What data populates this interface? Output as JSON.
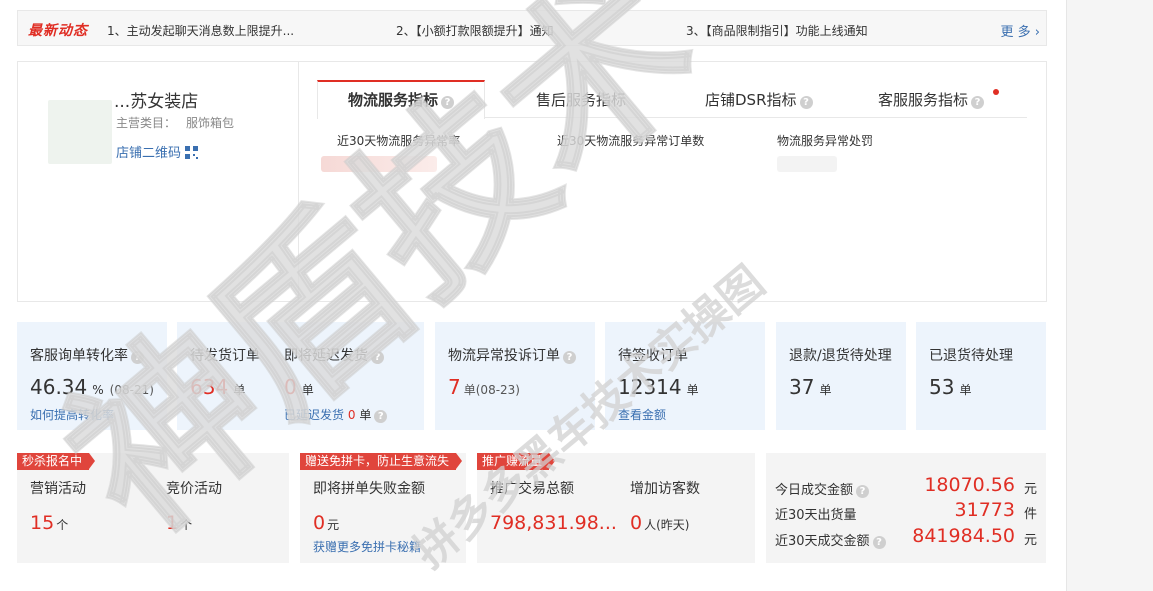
{
  "news": {
    "badge": "最新动态",
    "items": [
      "1、主动发起聊天消息数上限提升...",
      "2、【小额打款限额提升】通知",
      "3、【商品限制指引】功能上线通知"
    ],
    "more": "更 多 ›"
  },
  "shop": {
    "name": "...苏女装店",
    "category_label": "主营类目：",
    "category_value": "服饰箱包",
    "qr_link": "店铺二维码"
  },
  "tabs": [
    {
      "label": "物流服务指标",
      "active": true,
      "help": true
    },
    {
      "label": "售后服务指标",
      "active": false,
      "help": false
    },
    {
      "label": "店铺DSR指标",
      "active": false,
      "help": true
    },
    {
      "label": "客服服务指标",
      "active": false,
      "help": true,
      "dot": true
    }
  ],
  "metrics": [
    "近30天物流服务异常率",
    "近30天物流服务异常订单数",
    "物流服务异常处罚"
  ],
  "stats": {
    "conversion": {
      "title": "客服询单转化率",
      "value": "46.34",
      "unit": "%",
      "date": "(08-21)",
      "link": "如何提高转化率"
    },
    "pending_ship": {
      "title": "待发货订单",
      "value": "634",
      "unit": "单"
    },
    "delay_ship": {
      "title": "即将延迟发货",
      "value": "0",
      "unit": "单",
      "sub_label": "已延迟发货",
      "sub_value": "0",
      "sub_unit": "单"
    },
    "complaint": {
      "title": "物流异常投诉订单",
      "value": "7",
      "unit": "单",
      "date": "(08-23)"
    },
    "to_sign": {
      "title": "待签收订单",
      "value": "12314",
      "unit": "单",
      "link": "查看金额"
    },
    "refund": {
      "title": "退款/退货待处理",
      "value": "37",
      "unit": "单"
    },
    "returned": {
      "title": "已退货待处理",
      "value": "53",
      "unit": "单"
    }
  },
  "bottom": {
    "flash": {
      "ribbon": "秒杀报名中",
      "c1_label": "营销活动",
      "c1_value": "15",
      "c1_unit": "个",
      "c2_label": "竞价活动",
      "c2_value": "1",
      "c2_unit": "个"
    },
    "card": {
      "ribbon": "赠送免拼卡，防止生意流失",
      "label": "即将拼单失败金额",
      "value": "0",
      "unit": "元",
      "link": "获赠更多免拼卡秘籍"
    },
    "promo": {
      "ribbon": "推广赚流量",
      "c1_label": "推广交易总额",
      "c1_value": "798,831.98...",
      "c2_label": "增加访客数",
      "c2_value": "0",
      "c2_unit": "人(昨天)"
    },
    "summary": [
      {
        "label": "今日成交金额",
        "value": "18070.56",
        "unit": "元",
        "help": true
      },
      {
        "label": "近30天出货量",
        "value": "31773",
        "unit": "件",
        "help": false
      },
      {
        "label": "近30天成交金额",
        "value": "841984.50",
        "unit": "元",
        "help": true
      }
    ]
  },
  "watermark": {
    "main": "神盾技术",
    "sub": "拼多多黑车技术实操图"
  },
  "colors": {
    "accent_red": "#e02e24",
    "link_blue": "#3a6fb0",
    "card_blue": "#edf4fc",
    "card_gray": "#f4f4f4"
  }
}
